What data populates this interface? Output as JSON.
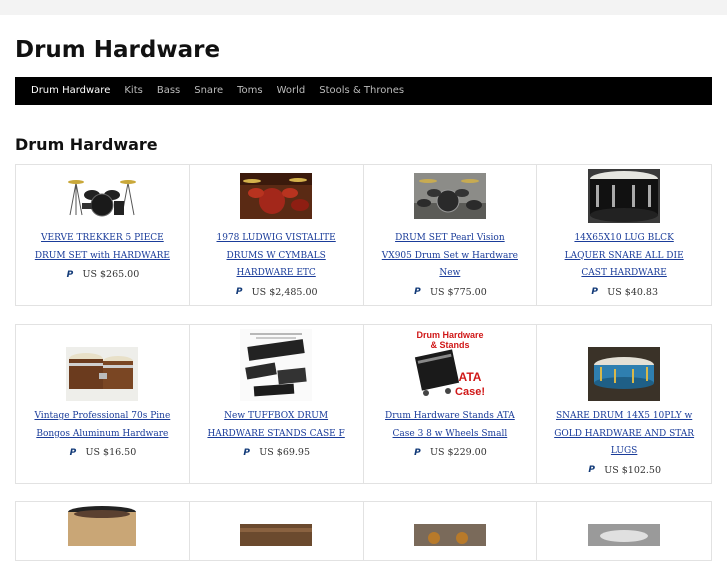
{
  "site": {
    "title": "Drum Hardware"
  },
  "nav": {
    "items": [
      "Drum Hardware",
      "Kits",
      "Bass",
      "Snare",
      "Toms",
      "World",
      "Stools & Thrones"
    ]
  },
  "section": {
    "title": "Drum Hardware"
  },
  "products": [
    {
      "title": "VERVE TREKKER 5 PIECE DRUM SET with HARDWARE",
      "price": "US $265.00",
      "thumb": "drum-kit-image"
    },
    {
      "title": "1978 LUDWIG VISTALITE DRUMS W CYMBALS HARDWARE ETC",
      "price": "US $2,485.00",
      "thumb": "red-drum-kit-image"
    },
    {
      "title": "DRUM SET Pearl Vision VX905 Drum Set w Hardware New",
      "price": "US $775.00",
      "thumb": "pearl-kit-image"
    },
    {
      "title": "14X65X10 LUG BLCK LAQUER SNARE ALL DIE CAST HARDWARE",
      "price": "US $40.83",
      "thumb": "black-snare-image"
    },
    {
      "title": "Vintage Professional 70s Pine Bongos Aluminum Hardware",
      "price": "US $16.50",
      "thumb": "bongos-image"
    },
    {
      "title": "New TUFFBOX DRUM HARDWARE STANDS CASE F",
      "price": "US $69.95",
      "thumb": "tuffbox-case-image"
    },
    {
      "title": "Drum Hardware Stands ATA Case 3 8 w Wheels Small",
      "price": "US $229.00",
      "thumb": "ata-case-image",
      "thumb_text": [
        "Drum Hardware",
        "& Stands",
        "ATA",
        "Case!"
      ]
    },
    {
      "title": "SNARE DRUM 14X5 10PLY w GOLD HARDWARE AND STAR LUGS",
      "price": "US $102.50",
      "thumb": "blue-snare-image"
    }
  ],
  "colors": {
    "link": "#1a3c9a",
    "nav_bg": "#000000",
    "border": "#e2e2e2",
    "paypal": "#123a78"
  }
}
